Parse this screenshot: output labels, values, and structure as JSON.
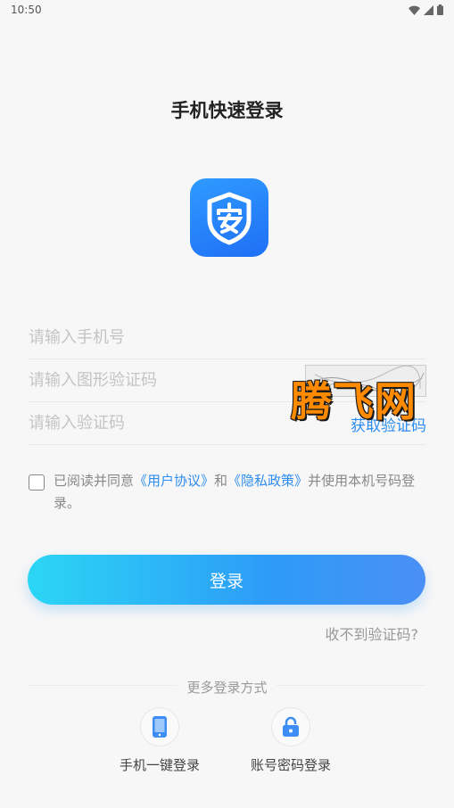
{
  "status_bar": {
    "time": "10:50"
  },
  "page": {
    "title": "手机快速登录"
  },
  "form": {
    "phone_placeholder": "请输入手机号",
    "captcha_placeholder": "请输入图形验证码",
    "sms_code_placeholder": "请输入验证码",
    "get_code_label": "获取验证码"
  },
  "agreement": {
    "prefix": "已阅读并同意",
    "user_agreement": "《用户协议》",
    "and": "和",
    "privacy_policy": "《隐私政策》",
    "suffix": "并使用本机号码登录。"
  },
  "login_button": "登录",
  "no_code_link": "收不到验证码?",
  "more_login": {
    "title": "更多登录方式",
    "options": [
      {
        "label": "手机一键登录",
        "icon": "phone-icon"
      },
      {
        "label": "账号密码登录",
        "icon": "lock-icon"
      }
    ]
  },
  "watermark": "腾飞网",
  "colors": {
    "accent": "#2d8cf0",
    "logo": "#1f7cf7",
    "watermark": "#ff8a00"
  }
}
